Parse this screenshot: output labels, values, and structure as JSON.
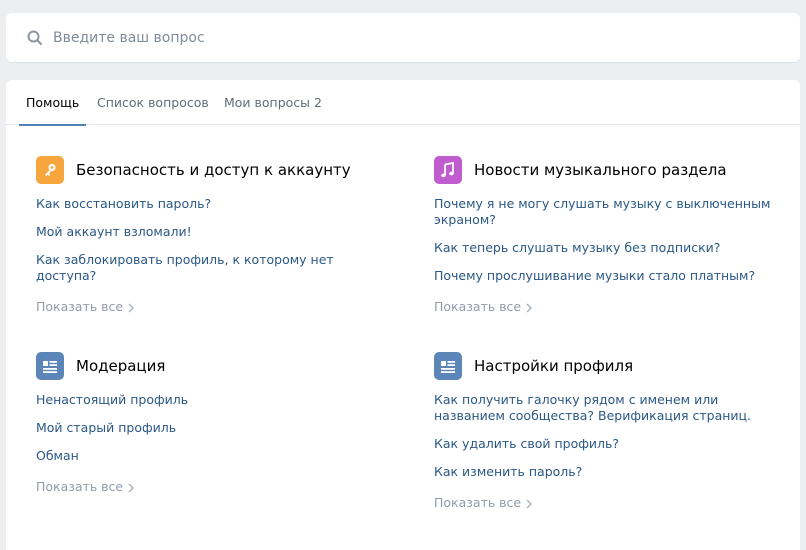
{
  "search": {
    "placeholder": "Введите ваш вопрос",
    "value": ""
  },
  "tabs": [
    {
      "label": "Помощь",
      "active": true
    },
    {
      "label": "Список вопросов",
      "active": false
    },
    {
      "label": "Мои вопросы",
      "count": "2",
      "active": false
    }
  ],
  "sections": [
    {
      "title": "Безопасность и доступ к аккаунту",
      "icon": "key-icon",
      "color": "#f7a63e",
      "questions": [
        "Как восстановить пароль?",
        "Мой аккаунт взломали!",
        "Как заблокировать профиль, к которому нет доступа?"
      ],
      "show_all": "Показать все"
    },
    {
      "title": "Новости музыкального раздела",
      "icon": "music-note-icon",
      "color": "#c15bd0",
      "questions": [
        "Почему я не могу слушать музыку с выключенным экраном?",
        "Как теперь слушать музыку без подписки?",
        "Почему прослушивание музыки стало платным?"
      ],
      "show_all": "Показать все"
    },
    {
      "title": "Модерация",
      "icon": "card-icon",
      "color": "#5d86b8",
      "questions": [
        "Ненастоящий профиль",
        "Мой старый профиль",
        "Обман"
      ],
      "show_all": "Показать все"
    },
    {
      "title": "Настройки профиля",
      "icon": "card-icon",
      "color": "#5d86b8",
      "questions": [
        "Как получить галочку рядом с именем или названием сообщества? Верификация страниц.",
        "Как удалить свой профиль?",
        "Как изменить пароль?"
      ],
      "show_all": "Показать все"
    }
  ]
}
